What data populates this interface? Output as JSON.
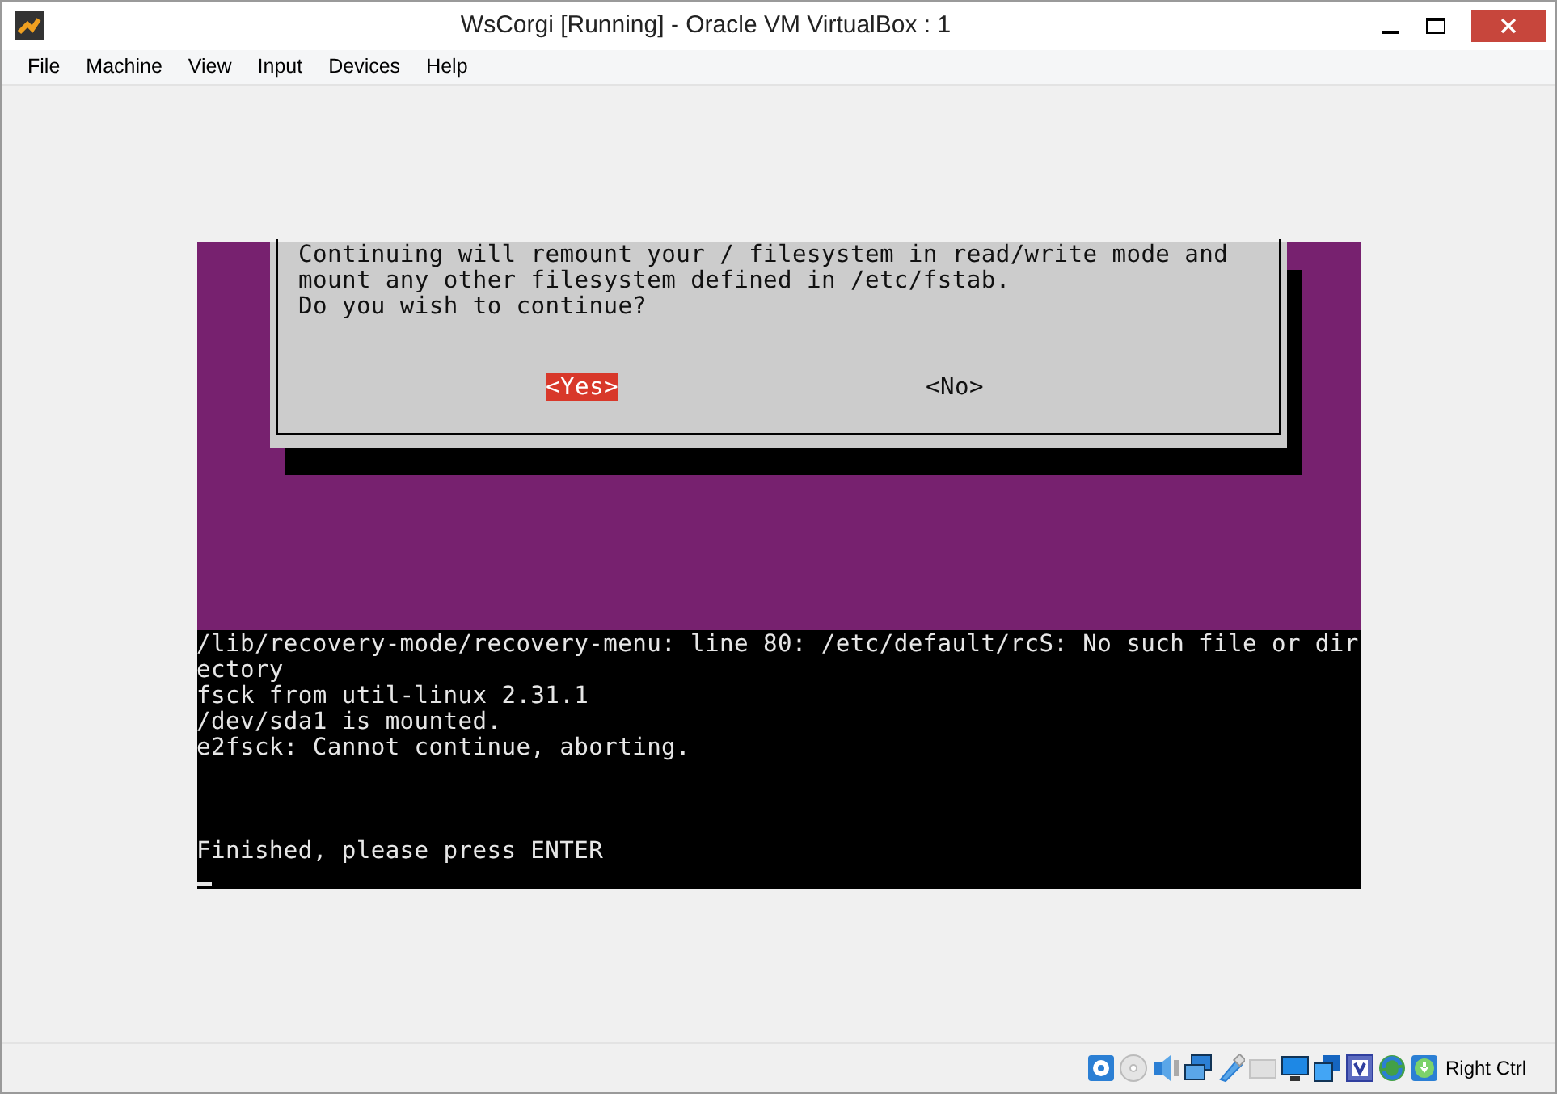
{
  "window": {
    "title": "WsCorgi [Running] - Oracle VM VirtualBox : 1"
  },
  "menu": [
    "File",
    "Machine",
    "View",
    "Input",
    "Devices",
    "Help"
  ],
  "vm_screen": {
    "dialog": {
      "lines": [
        "Continuing will remount your / filesystem in read/write mode and",
        "mount any other filesystem defined in /etc/fstab.",
        "Do you wish to continue?"
      ],
      "buttons": [
        {
          "label": "<Yes>",
          "selected": true
        },
        {
          "label": "<No>",
          "selected": false
        }
      ]
    },
    "terminal": {
      "lines": [
        "/lib/recovery-mode/recovery-menu: line 80: /etc/default/rcS: No such file or dir",
        "ectory",
        "fsck from util-linux 2.31.1",
        "/dev/sda1 is mounted.",
        "e2fsck: Cannot continue, aborting."
      ],
      "prompt": "Finished, please press ENTER"
    }
  },
  "status_bar": {
    "host_key": "Right Ctrl"
  }
}
